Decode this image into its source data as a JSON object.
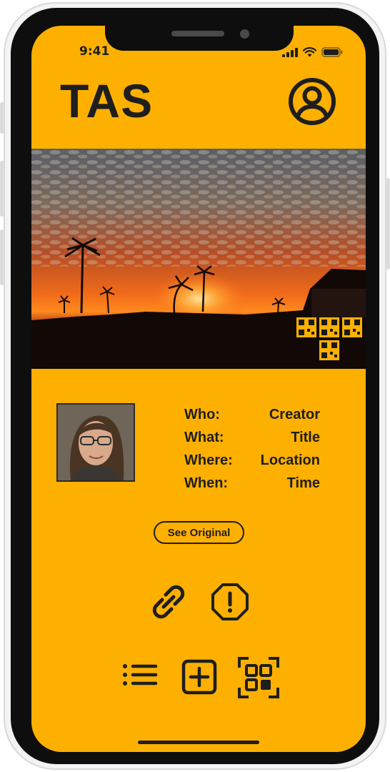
{
  "status_bar": {
    "time": "9:41"
  },
  "header": {
    "logo_text": "TAS",
    "profile_icon": "user-circle-icon"
  },
  "photo": {
    "description_icon": "qr-watermark",
    "subject": "sunset-palm-trees"
  },
  "metadata": {
    "rows": [
      {
        "label": "Who:",
        "value": "Creator"
      },
      {
        "label": "What:",
        "value": "Title"
      },
      {
        "label": "Where:",
        "value": "Location"
      },
      {
        "label": "When:",
        "value": "Time"
      }
    ]
  },
  "actions": {
    "see_original_label": "See Original",
    "link_icon": "link-icon",
    "report_icon": "alert-octagon-icon"
  },
  "bottom_nav": {
    "items": [
      {
        "icon": "list-icon"
      },
      {
        "icon": "add-square-icon"
      },
      {
        "icon": "qr-scan-icon"
      }
    ]
  },
  "colors": {
    "accent": "#fdb000",
    "ink": "#1e1e1e",
    "bezel": "#0e0e0e"
  }
}
